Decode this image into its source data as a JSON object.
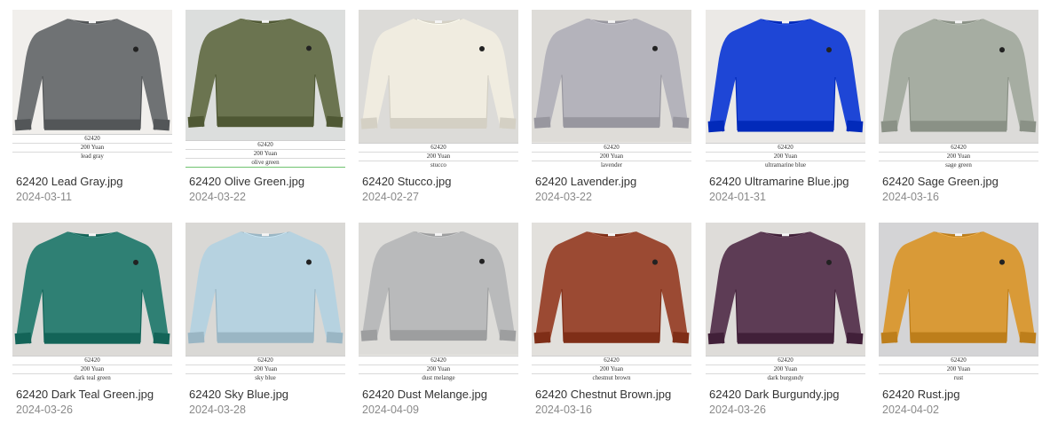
{
  "files": [
    {
      "name": "62420 Lead Gray.jpg",
      "date": "2024-03-11",
      "tag": {
        "code": "62420",
        "price": "200 Yuan",
        "color": "lead gray"
      },
      "sweater_color": "#6f7274",
      "bg_color": "#f1efec"
    },
    {
      "name": "62420 Olive Green.jpg",
      "date": "2024-03-22",
      "tag": {
        "code": "62420",
        "price": "200 Yuan",
        "color": "olive green"
      },
      "sweater_color": "#6b7450",
      "bg_color": "#dcdedd"
    },
    {
      "name": "62420 Stucco.jpg",
      "date": "2024-02-27",
      "tag": {
        "code": "62420",
        "price": "200 Yuan",
        "color": "stucco"
      },
      "sweater_color": "#f0ece0",
      "bg_color": "#dcdbd8"
    },
    {
      "name": "62420 Lavender.jpg",
      "date": "2024-03-22",
      "tag": {
        "code": "62420",
        "price": "200 Yuan",
        "color": "lavender"
      },
      "sweater_color": "#b4b3bb",
      "bg_color": "#dedcd8"
    },
    {
      "name": "62420 Ultramarine Blue.jpg",
      "date": "2024-01-31",
      "tag": {
        "code": "62420",
        "price": "200 Yuan",
        "color": "ultramarine blue"
      },
      "sweater_color": "#1e46d6",
      "bg_color": "#ebe9e6"
    },
    {
      "name": "62420 Sage Green.jpg",
      "date": "2024-03-16",
      "tag": {
        "code": "62420",
        "price": "200 Yuan",
        "color": "sage green"
      },
      "sweater_color": "#a6ada2",
      "bg_color": "#dcdbd9"
    },
    {
      "name": "62420 Dark Teal Green.jpg",
      "date": "2024-03-26",
      "tag": {
        "code": "62420",
        "price": "200 Yuan",
        "color": "dark teal green"
      },
      "sweater_color": "#2f8074",
      "bg_color": "#dcdad7"
    },
    {
      "name": "62420 Sky Blue.jpg",
      "date": "2024-03-28",
      "tag": {
        "code": "62420",
        "price": "200 Yuan",
        "color": "sky blue"
      },
      "sweater_color": "#b6d2e0",
      "bg_color": "#d9d8d5"
    },
    {
      "name": "62420 Dust Melange.jpg",
      "date": "2024-04-09",
      "tag": {
        "code": "62420",
        "price": "200 Yuan",
        "color": "dust melange"
      },
      "sweater_color": "#b9babb",
      "bg_color": "#dddcd9"
    },
    {
      "name": "62420 Chestnut Brown.jpg",
      "date": "2024-03-16",
      "tag": {
        "code": "62420",
        "price": "200 Yuan",
        "color": "chestnut brown"
      },
      "sweater_color": "#9b4a33",
      "bg_color": "#e2e0dc"
    },
    {
      "name": "62420 Dark Burgundy.jpg",
      "date": "2024-03-26",
      "tag": {
        "code": "62420",
        "price": "200 Yuan",
        "color": "dark burgundy"
      },
      "sweater_color": "#5d3c55",
      "bg_color": "#dedcd9"
    },
    {
      "name": "62420 Rust.jpg",
      "date": "2024-04-02",
      "tag": {
        "code": "62420",
        "price": "200 Yuan",
        "color": "rust"
      },
      "sweater_color": "#d99a37",
      "bg_color": "#d4d4d6"
    }
  ]
}
